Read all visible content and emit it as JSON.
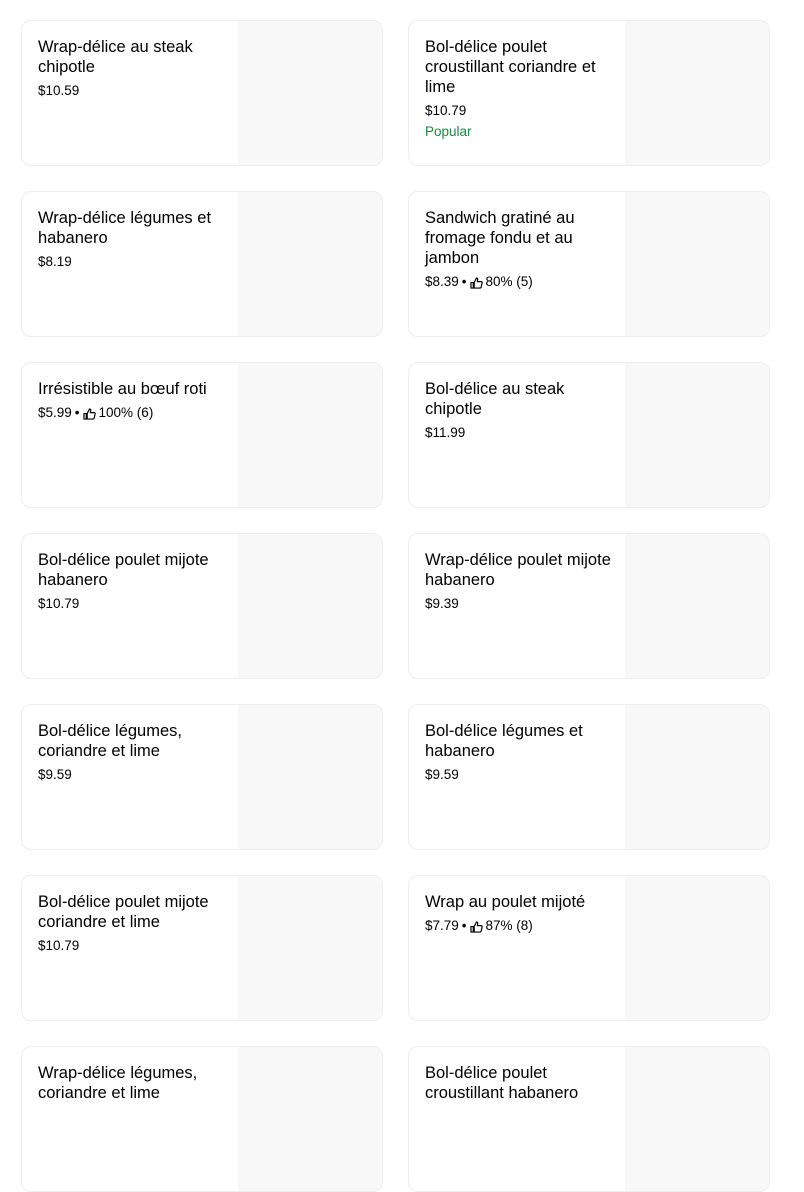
{
  "items": [
    {
      "title": "Wrap-délice au steak chipotle",
      "price": "$10.59"
    },
    {
      "title": "Bol-délice poulet croustillant coriandre et lime",
      "price": "$10.79",
      "badge": "Popular"
    },
    {
      "title": "Wrap-délice légumes et habanero",
      "price": "$8.19"
    },
    {
      "title": "Sandwich gratiné au fromage fondu et au jambon",
      "price": "$8.39",
      "rating": "80% (5)"
    },
    {
      "title": "Irrésistible au bœuf roti",
      "price": "$5.99",
      "rating": "100% (6)"
    },
    {
      "title": "Bol-délice au steak chipotle",
      "price": "$11.99"
    },
    {
      "title": "Bol-délice poulet mijote habanero",
      "price": "$10.79"
    },
    {
      "title": "Wrap-délice poulet mijote habanero",
      "price": "$9.39"
    },
    {
      "title": "Bol-délice légumes, coriandre et lime",
      "price": "$9.59"
    },
    {
      "title": "Bol-délice légumes et habanero",
      "price": "$9.59"
    },
    {
      "title": "Bol-délice poulet mijote coriandre et lime",
      "price": "$10.79"
    },
    {
      "title": "Wrap au poulet mijoté",
      "price": "$7.79",
      "rating": "87% (8)"
    },
    {
      "title": "Wrap-délice légumes, coriandre et lime",
      "price": ""
    },
    {
      "title": "Bol-délice poulet croustillant habanero",
      "price": ""
    }
  ],
  "separator": "•",
  "colors": {
    "badge": "#1c8a3f",
    "card_border": "#eeeeee",
    "thumb_bg": "#f8f8f8"
  },
  "icons": {
    "rating": "thumbs-up-icon"
  }
}
